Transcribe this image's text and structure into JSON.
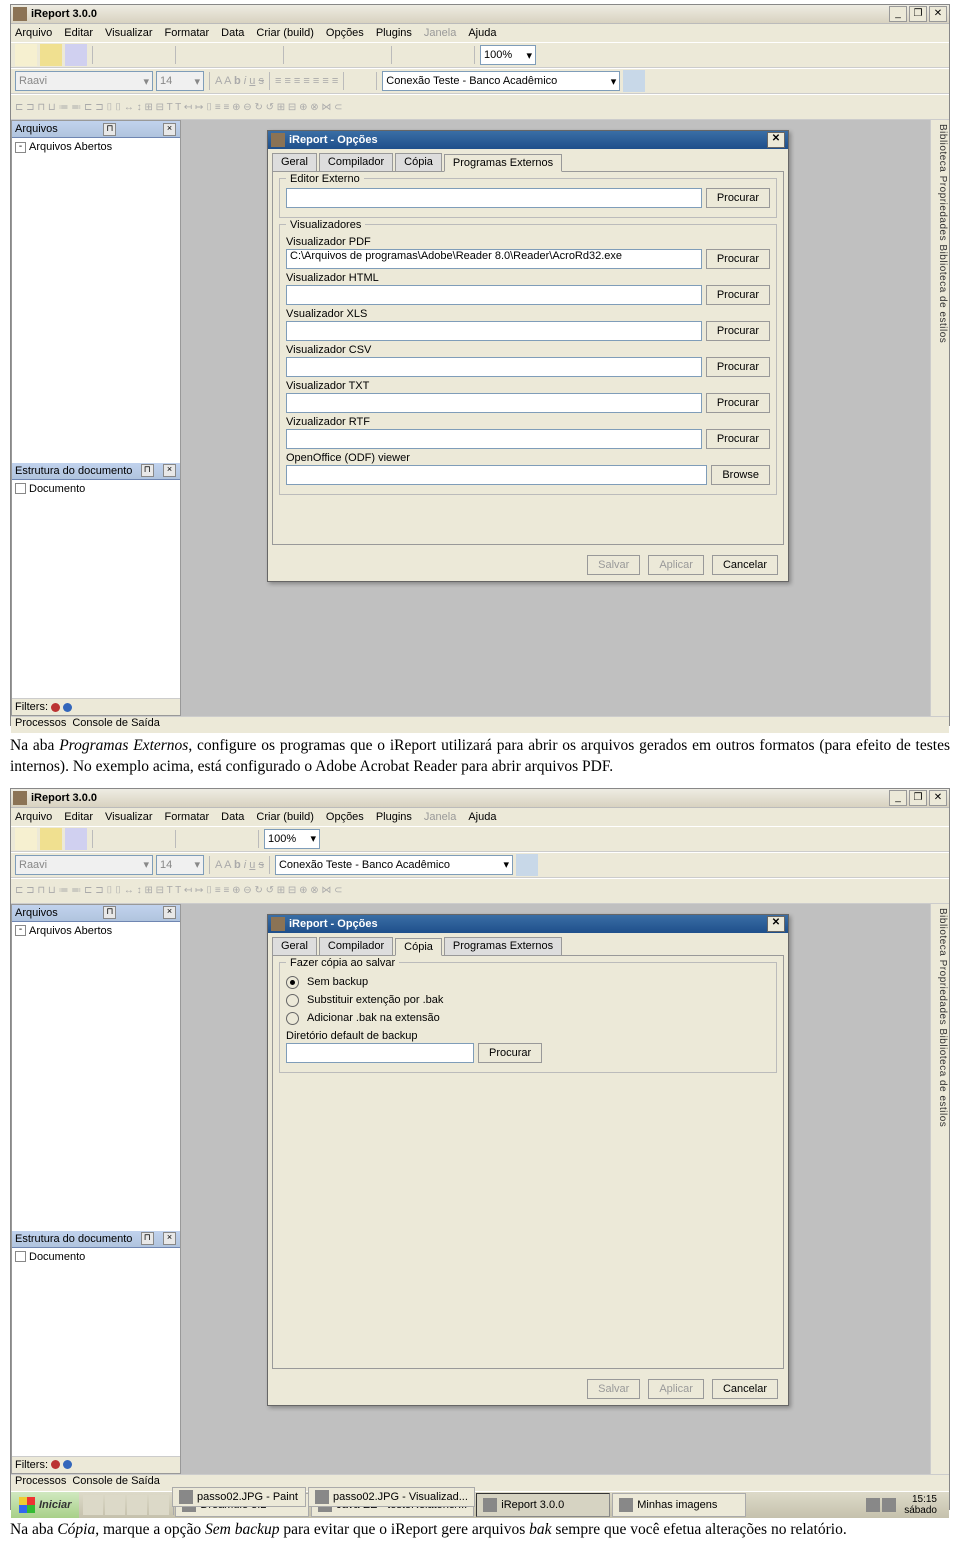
{
  "paragraphs": {
    "p1_a": "Na aba ",
    "p1_i1": "Programas Externos",
    "p1_b": ", configure os programas que o iReport utilizará para abrir os arquivos gerados em outros formatos (para efeito de testes internos). No exemplo acima, está configurado o Adobe Acrobat Reader para abrir arquivos PDF.",
    "p2_a": "Na aba ",
    "p2_i1": "Cópia",
    "p2_b": ", marque a opção ",
    "p2_i2": "Sem backup",
    "p2_c": " para evitar que o iReport gere arquivos ",
    "p2_i3": "bak",
    "p2_d": " sempre que você efetua alterações no relatório."
  },
  "ireport": {
    "title": "iReport 3.0.0",
    "menus": [
      "Arquivo",
      "Editar",
      "Visualizar",
      "Formatar",
      "Data",
      "Criar (build)",
      "Opções",
      "Plugins",
      "Janela",
      "Ajuda"
    ],
    "zoom": "100%",
    "font": "Raavi",
    "fontsize": "14",
    "datasource": "Conexão Teste - Banco Acadêmico",
    "panels": {
      "arquivos": "Arquivos",
      "arquivos_tree": "Arquivos Abertos",
      "estrutura": "Estrutura do documento",
      "estrutura_tree": "Documento",
      "filters": "Filters:",
      "processos": "Processos",
      "console": "Console de Saída",
      "rightstrip": "Biblioteca  Propriedades  Biblioteca de estilos"
    },
    "dialog": {
      "title": "iReport - Opções",
      "tabs": [
        "Geral",
        "Compilador",
        "Cópia",
        "Programas Externos"
      ],
      "active_programas": "Programas Externos",
      "active_copia": "Cópia",
      "editor_externo": "Editor Externo",
      "visualizadores": "Visualizadores",
      "vis_pdf": "Visualizador PDF",
      "vis_pdf_val": "C:\\Arquivos de programas\\Adobe\\Reader 8.0\\Reader\\AcroRd32.exe",
      "vis_html": "Visualizador HTML",
      "vis_xls": "Vsualizador XLS",
      "vis_csv": "Visualizador CSV",
      "vis_txt": "Visualizador TXT",
      "vis_rtf": "Vizualizador RTF",
      "vis_odf": "OpenOffice (ODF) viewer",
      "procurar": "Procurar",
      "browse": "Browse",
      "salvar": "Salvar",
      "aplicar": "Aplicar",
      "cancelar": "Cancelar",
      "copia_group": "Fazer cópia ao salvar",
      "r1": "Sem backup",
      "r2": "Substituir extenção por .bak",
      "r3": "Adicionar .bak na extensão",
      "dir_label": "Diretório default de backup"
    }
  },
  "taskbar": {
    "iniciar": "Iniciar",
    "tasks": [
      "DreaMule 3.2",
      "Java EE - testeRelatorio/...",
      "iReport 3.0.0",
      "Minhas imagens",
      "passo02.JPG - Paint",
      "passo02.JPG - Visualizad..."
    ],
    "time": "15:15",
    "day": "sábado"
  }
}
